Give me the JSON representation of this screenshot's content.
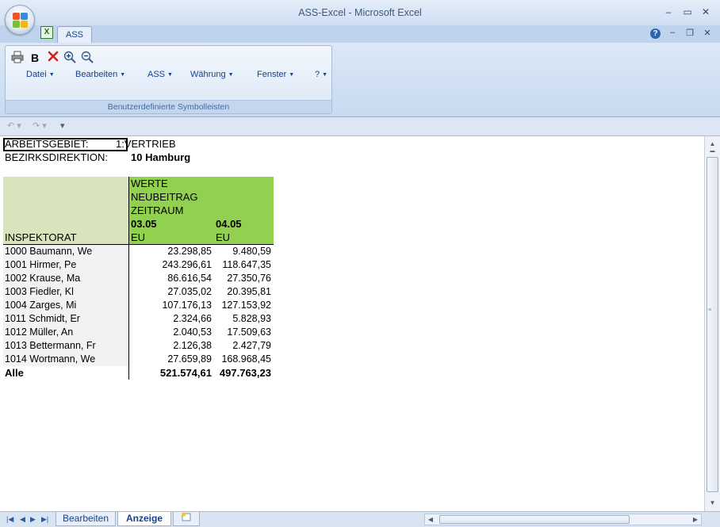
{
  "window": {
    "title": "ASS-Excel - Microsoft Excel"
  },
  "window_controls": {
    "minimize": "–",
    "maximize": "▭",
    "close": "✕"
  },
  "ribbon": {
    "tab_label": "ASS",
    "group_caption": "Benutzerdefinierte Symbolleisten",
    "bold_label": "B",
    "menus": [
      {
        "label": "Datei"
      },
      {
        "label": "Bearbeiten"
      },
      {
        "label": "ASS"
      },
      {
        "label": "Währung"
      },
      {
        "label": "Fenster"
      },
      {
        "label": "?"
      }
    ],
    "tools": [
      "print-icon",
      "bold-icon",
      "delete-x-icon",
      "zoom-in-icon",
      "zoom-out-icon"
    ]
  },
  "doc_controls": {
    "help": "?",
    "minimize": "–",
    "restore": "❐",
    "close": "✕"
  },
  "sheet": {
    "arbeitsgebiet_label": "ARBEITSGEBIET:",
    "arbeitsgebiet_value": "1:VERTRIEB",
    "bezirk_label": "BEZIRKSDIREKTION:",
    "bezirk_value": "10 Hamburg",
    "pivot": {
      "werte": "WERTE",
      "neubeitrag": "NEUBEITRAG",
      "zeitraum": "ZEITRAUM",
      "col1": "03.05",
      "col2": "04.05",
      "unit1": "EU",
      "unit2": "EU",
      "row_header": "INSPEKTORAT",
      "rows": [
        {
          "name": "1000 Baumann, We",
          "v1": "23.298,85",
          "v2": "9.480,59"
        },
        {
          "name": "1001 Hirmer, Pe",
          "v1": "243.296,61",
          "v2": "118.647,35"
        },
        {
          "name": "1002 Krause, Ma",
          "v1": "86.616,54",
          "v2": "27.350,76"
        },
        {
          "name": "1003 Fiedler, Kl",
          "v1": "27.035,02",
          "v2": "20.395,81"
        },
        {
          "name": "1004 Zarges, Mi",
          "v1": "107.176,13",
          "v2": "127.153,92"
        },
        {
          "name": "1011 Schmidt, Er",
          "v1": "2.324,66",
          "v2": "5.828,93"
        },
        {
          "name": "1012 Müller, An",
          "v1": "2.040,53",
          "v2": "17.509,63"
        },
        {
          "name": "1013 Bettermann, Fr",
          "v1": "2.126,38",
          "v2": "2.427,79"
        },
        {
          "name": "1014 Wortmann, We",
          "v1": "27.659,89",
          "v2": "168.968,45"
        }
      ],
      "total": {
        "name": "Alle",
        "v1": "521.574,61",
        "v2": "497.763,23"
      }
    }
  },
  "sheet_tabs": [
    {
      "label": "Bearbeiten",
      "active": false
    },
    {
      "label": "Anzeige",
      "active": true
    }
  ],
  "colors": {
    "pivot_header": "#92d050",
    "row_header": "#d8e4bc",
    "ribbon_text": "#15428b"
  }
}
